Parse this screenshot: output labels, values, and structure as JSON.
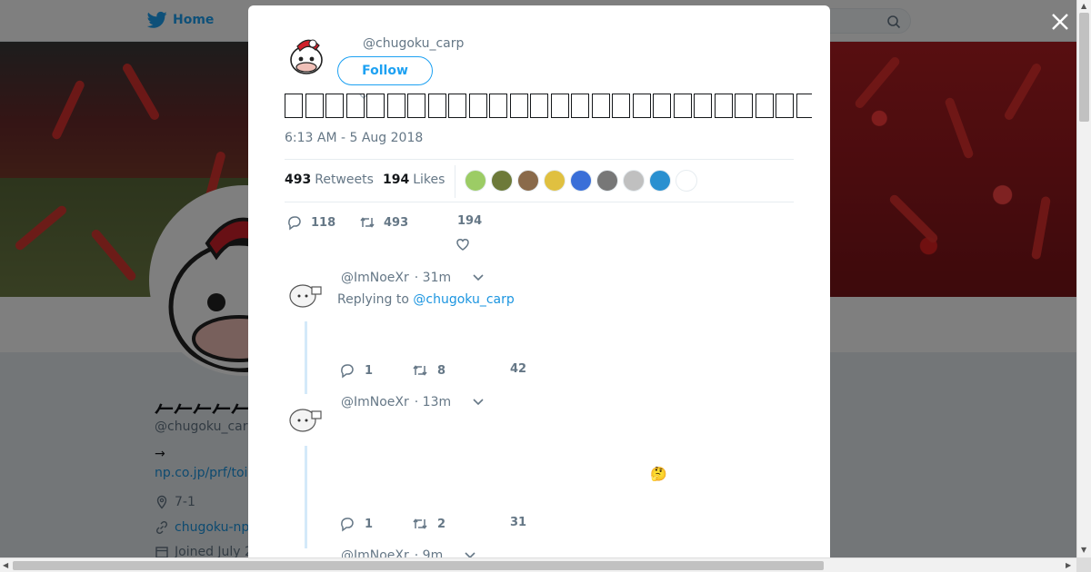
{
  "background": {
    "nav_home": "Home",
    "profile_name_visible": "𠂉𠂉𠂉𠂉𠂉𠂉𠂉𠂉",
    "profile_handle": "@chugoku_carp",
    "bio_arrow": "→",
    "bio_link": "np.co.jp/prf/toi",
    "location": "7-1",
    "website": "chugoku-np",
    "joined": "Joined July 2"
  },
  "modal": {
    "handle": "@chugoku_carp",
    "follow_label": "Follow",
    "tweet_text_glyph_count": 27,
    "timestamp": "6:13 AM - 5 Aug 2018",
    "retweets_count": "493",
    "retweets_label": "Retweets",
    "likes_count": "194",
    "likes_label": "Likes",
    "likers_colors": [
      "#9ccc65",
      "#6d7a3a",
      "#8a6a4a",
      "#e0c040",
      "#3a6fd8",
      "#777777",
      "#c0c0c0",
      "#2a90d0",
      "#ffffff"
    ],
    "actions": {
      "replies": "118",
      "retweets": "493",
      "likes": "194"
    }
  },
  "replies": [
    {
      "handle": "@ImNoeXr",
      "time": "· 31m",
      "replying_prefix": "Replying to",
      "replying_to": "@chugoku_carp",
      "replies": "1",
      "retweets": "8",
      "likes": "42"
    },
    {
      "handle": "@ImNoeXr",
      "time": "· 13m",
      "emoji": "🤔",
      "replies": "1",
      "retweets": "2",
      "likes": "31"
    },
    {
      "handle": "@ImNoeXr",
      "time": "· 9m"
    }
  ],
  "colors": {
    "twitter_blue": "#1da1f2",
    "link": "#1b95e0",
    "muted": "#657786"
  }
}
